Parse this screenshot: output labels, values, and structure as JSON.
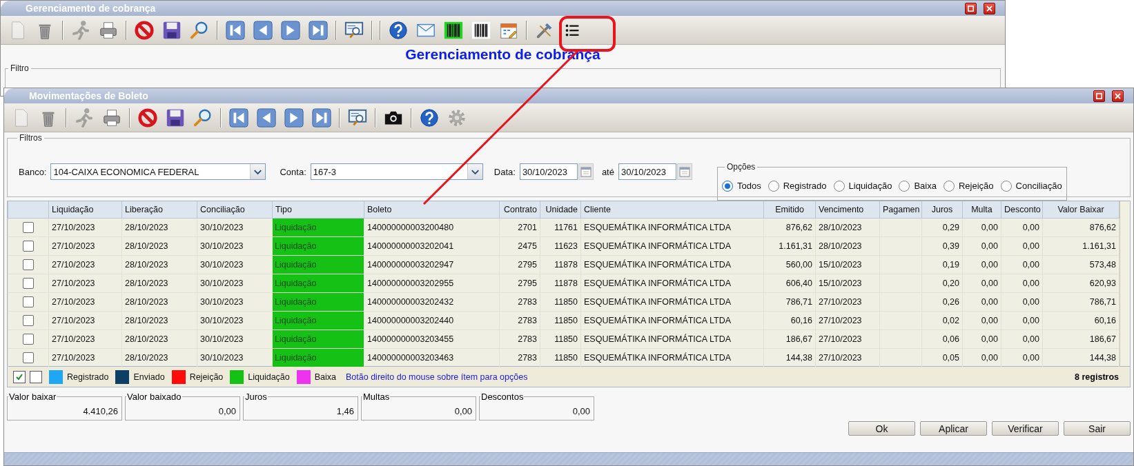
{
  "top_window": {
    "title": "Gerenciamento de cobrança",
    "toolbar": [
      {
        "kind": "new",
        "disabled": true
      },
      {
        "kind": "delete",
        "disabled": false
      },
      {
        "kind": "separator"
      },
      {
        "kind": "run",
        "disabled": true
      },
      {
        "kind": "print",
        "disabled": false
      },
      {
        "kind": "separator"
      },
      {
        "kind": "cancel",
        "disabled": false
      },
      {
        "kind": "save",
        "disabled": false
      },
      {
        "kind": "search",
        "disabled": false
      },
      {
        "kind": "separator"
      },
      {
        "kind": "first",
        "disabled": false
      },
      {
        "kind": "prev",
        "disabled": false
      },
      {
        "kind": "next",
        "disabled": false
      },
      {
        "kind": "last",
        "disabled": false
      },
      {
        "kind": "separator"
      },
      {
        "kind": "preview",
        "disabled": false
      },
      {
        "kind": "separator"
      },
      {
        "kind": "separator"
      },
      {
        "kind": "help",
        "disabled": false
      },
      {
        "kind": "mail",
        "disabled": false
      },
      {
        "kind": "barcode-green",
        "disabled": false
      },
      {
        "kind": "barcode",
        "disabled": false
      },
      {
        "kind": "calendar",
        "disabled": false
      },
      {
        "kind": "separator"
      },
      {
        "kind": "tools",
        "disabled": false
      },
      {
        "kind": "list",
        "disabled": false
      }
    ],
    "heading": "Gerenciamento de cobrança",
    "filter_legend": "Filtro"
  },
  "window": {
    "title": "Movimentações de Boleto",
    "toolbar": [
      {
        "kind": "new",
        "disabled": true
      },
      {
        "kind": "delete",
        "disabled": false
      },
      {
        "kind": "separator"
      },
      {
        "kind": "run",
        "disabled": true
      },
      {
        "kind": "print",
        "disabled": false
      },
      {
        "kind": "separator"
      },
      {
        "kind": "cancel",
        "disabled": false
      },
      {
        "kind": "save",
        "disabled": false
      },
      {
        "kind": "search",
        "disabled": false
      },
      {
        "kind": "separator"
      },
      {
        "kind": "first",
        "disabled": false
      },
      {
        "kind": "prev",
        "disabled": false
      },
      {
        "kind": "next",
        "disabled": false
      },
      {
        "kind": "last",
        "disabled": false
      },
      {
        "kind": "separator"
      },
      {
        "kind": "preview",
        "disabled": false
      },
      {
        "kind": "separator"
      },
      {
        "kind": "camera",
        "disabled": false
      },
      {
        "kind": "separator"
      },
      {
        "kind": "help",
        "disabled": false
      },
      {
        "kind": "settings",
        "disabled": true
      }
    ],
    "filters": {
      "legend": "Filtros",
      "banco_label": "Banco:",
      "banco": "104-CAIXA ECONOMICA FEDERAL",
      "conta_label": "Conta:",
      "conta": "167-3",
      "data_label": "Data:",
      "data_from": "30/10/2023",
      "ate_label": "até",
      "data_to": "30/10/2023",
      "options": {
        "legend": "Opções",
        "items": [
          {
            "label": "Todos",
            "selected": true
          },
          {
            "label": "Registrado",
            "selected": false
          },
          {
            "label": "Liquidação",
            "selected": false
          },
          {
            "label": "Baixa",
            "selected": false
          },
          {
            "label": "Rejeição",
            "selected": false
          },
          {
            "label": "Conciliação",
            "selected": false
          }
        ]
      }
    },
    "table": {
      "columns": [
        "Liquidação",
        "Liberação",
        "Conciliação",
        "Tipo",
        "Boleto",
        "Contrato",
        "Unidade",
        "Cliente",
        "Emitido",
        "Vencimento",
        "Pagamen",
        "Juros",
        "Multa",
        "Desconto",
        "Valor Baixar"
      ],
      "rows": [
        {
          "checked": false,
          "liquidacao": "27/10/2023",
          "liberacao": "28/10/2023",
          "conciliacao": "30/10/2023",
          "tipo": {
            "label": "Liquidação",
            "color": "#14c114"
          },
          "boleto": "140000000003200480",
          "contrato": "2701",
          "unidade": "11761",
          "cliente": "ESQUEMÁTIKA INFORMÁTICA LTDA",
          "emitido": "876,62",
          "vencimento": "28/10/2023",
          "juros": "0,29",
          "multa": "0,00",
          "descontos": "0,00",
          "valor_baixar": "876,62"
        },
        {
          "checked": false,
          "liquidacao": "27/10/2023",
          "liberacao": "28/10/2023",
          "conciliacao": "30/10/2023",
          "tipo": {
            "label": "Liquidação",
            "color": "#14c114"
          },
          "boleto": "140000000003202041",
          "contrato": "2475",
          "unidade": "11623",
          "cliente": "ESQUEMÁTIKA INFORMÁTICA LTDA",
          "emitido": "1.161,31",
          "vencimento": "28/10/2023",
          "juros": "0,39",
          "multa": "0,00",
          "descontos": "0,00",
          "valor_baixar": "1.161,31"
        },
        {
          "checked": false,
          "liquidacao": "27/10/2023",
          "liberacao": "28/10/2023",
          "conciliacao": "30/10/2023",
          "tipo": {
            "label": "Liquidação",
            "color": "#14c114"
          },
          "boleto": "140000000003202947",
          "contrato": "2795",
          "unidade": "11878",
          "cliente": "ESQUEMÁTIKA INFORMÁTICA LTDA",
          "emitido": "560,00",
          "vencimento": "15/10/2023",
          "juros": "0,19",
          "multa": "0,00",
          "descontos": "0,00",
          "valor_baixar": "573,48"
        },
        {
          "checked": false,
          "liquidacao": "27/10/2023",
          "liberacao": "28/10/2023",
          "conciliacao": "30/10/2023",
          "tipo": {
            "label": "Liquidação",
            "color": "#14c114"
          },
          "boleto": "140000000003202955",
          "contrato": "2795",
          "unidade": "11878",
          "cliente": "ESQUEMÁTIKA INFORMÁTICA LTDA",
          "emitido": "606,40",
          "vencimento": "15/10/2023",
          "juros": "0,20",
          "multa": "0,00",
          "descontos": "0,00",
          "valor_baixar": "620,93"
        },
        {
          "checked": false,
          "liquidacao": "27/10/2023",
          "liberacao": "28/10/2023",
          "conciliacao": "30/10/2023",
          "tipo": {
            "label": "Liquidação",
            "color": "#14c114"
          },
          "boleto": "140000000003202432",
          "contrato": "2783",
          "unidade": "11850",
          "cliente": "ESQUEMÁTIKA INFORMÁTICA LTDA",
          "emitido": "786,71",
          "vencimento": "27/10/2023",
          "juros": "0,26",
          "multa": "0,00",
          "descontos": "0,00",
          "valor_baixar": "786,71"
        },
        {
          "checked": false,
          "liquidacao": "27/10/2023",
          "liberacao": "28/10/2023",
          "conciliacao": "30/10/2023",
          "tipo": {
            "label": "Liquidação",
            "color": "#14c114"
          },
          "boleto": "140000000003202440",
          "contrato": "2783",
          "unidade": "11850",
          "cliente": "ESQUEMÁTIKA INFORMÁTICA LTDA",
          "emitido": "60,16",
          "vencimento": "27/10/2023",
          "juros": "0,02",
          "multa": "0,00",
          "descontos": "0,00",
          "valor_baixar": "60,16"
        },
        {
          "checked": false,
          "liquidacao": "27/10/2023",
          "liberacao": "28/10/2023",
          "conciliacao": "30/10/2023",
          "tipo": {
            "label": "Liquidação",
            "color": "#14c114"
          },
          "boleto": "140000000003203455",
          "contrato": "2783",
          "unidade": "11850",
          "cliente": "ESQUEMÁTIKA INFORMÁTICA LTDA",
          "emitido": "186,67",
          "vencimento": "27/10/2023",
          "juros": "0,06",
          "multa": "0,00",
          "descontos": "0,00",
          "valor_baixar": "186,67"
        },
        {
          "checked": false,
          "liquidacao": "27/10/2023",
          "liberacao": "28/10/2023",
          "conciliacao": "30/10/2023",
          "tipo": {
            "label": "Liquidação",
            "color": "#14c114"
          },
          "boleto": "140000000003203463",
          "contrato": "2783",
          "unidade": "11850",
          "cliente": "ESQUEMÁTIKA INFORMÁTICA LTDA",
          "emitido": "144,38",
          "vencimento": "27/10/2023",
          "juros": "0,05",
          "multa": "0,00",
          "descontos": "0,00",
          "valor_baixar": "144,38"
        }
      ]
    },
    "legend": {
      "items": [
        {
          "label": "Registrado",
          "color": "#1ea7f5"
        },
        {
          "label": "Enviado",
          "color": "#0d3e63"
        },
        {
          "label": "Rejeição",
          "color": "#ff0a0a"
        },
        {
          "label": "Liquidação",
          "color": "#14c114"
        },
        {
          "label": "Baixa",
          "color": "#ee33ee"
        }
      ],
      "hint": "Botão direito do mouse sobre ítem para opções",
      "count": "8 registros"
    },
    "summary": [
      {
        "label": "Valor baixar",
        "value": "4.410,26"
      },
      {
        "label": "Valor baixado",
        "value": "0,00"
      },
      {
        "label": "Juros",
        "value": "1,46"
      },
      {
        "label": "Multas",
        "value": "0,00"
      },
      {
        "label": "Descontos",
        "value": "0,00"
      }
    ],
    "buttons": [
      "Ok",
      "Aplicar",
      "Verificar",
      "Sair"
    ]
  }
}
